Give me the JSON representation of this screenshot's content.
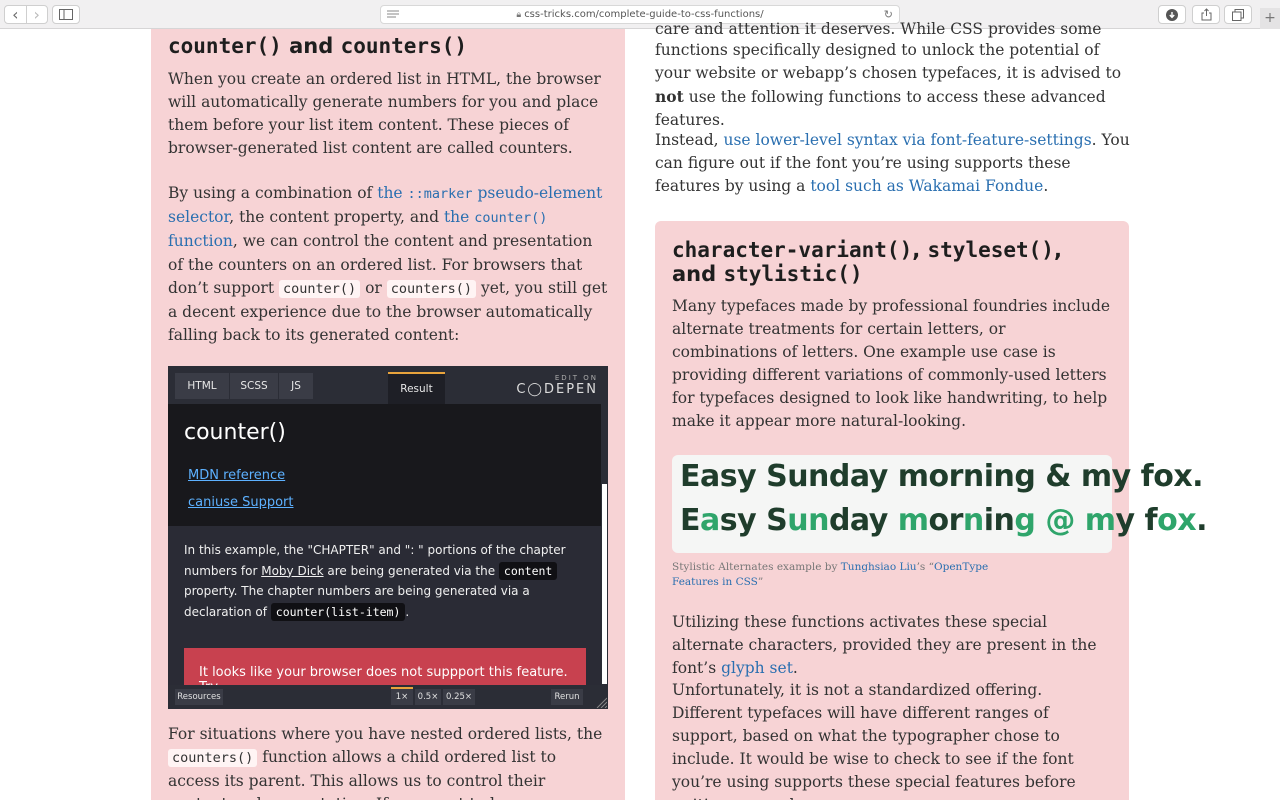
{
  "browser": {
    "url": "css-tricks.com/complete-guide-to-css-functions/",
    "back_glyph": "‹",
    "forward_glyph": "›",
    "icons": [
      "chevron-left-icon",
      "chevron-right-icon",
      "sidebar-icon",
      "reader-icon",
      "lock-icon",
      "reload-icon",
      "download-icon",
      "share-icon",
      "tabs-icon",
      "plus-icon"
    ]
  },
  "left": {
    "heading_code_1": "counter()",
    "heading_and": " and ",
    "heading_code_2": "counters()",
    "p1": "When you create an ordered list in HTML, the browser will automatically generate numbers for you and place them before your list item content. These pieces of browser-generated list content are called counters.",
    "p2_a": "By using a combination of ",
    "p2_link1_pre": "the ",
    "p2_link1_code": "::marker",
    "p2_link1_post": " pseudo-element selector",
    "p2_b": ", the content property, and ",
    "p2_link2_pre": "the ",
    "p2_link2_code": "counter()",
    "p2_link2_post": " function",
    "p2_c": ", we can control the content and presentation of the counters on an ordered list. For browsers that don’t support ",
    "p2_code1": "counter()",
    "p2_or": " or ",
    "p2_code2": "counters()",
    "p2_d": " yet, you still get a decent experience due to the browser automatically falling back to its generated content:",
    "p3_a": "For situations where you have nested ordered lists, the ",
    "p3_code": "counters()",
    "p3_b": " function allows a child ordered list to access its parent. This allows us to control their content and presentation. If you want to learn more about the power of"
  },
  "codepen": {
    "tabs": [
      "HTML",
      "SCSS",
      "JS"
    ],
    "result_tab": "Result",
    "logo_small": "EDIT ON",
    "logo_big": "C◯DEPEN",
    "title": "counter()",
    "link1": "MDN reference",
    "link2": "caniuse Support",
    "desc_a": "In this example, the \"CHAPTER\" and \": \" portions of the chapter numbers for ",
    "desc_link": "Moby Dick",
    "desc_b": " are being generated via the ",
    "desc_code1": "content",
    "desc_c": " property. The chapter numbers are being generated via a declaration of ",
    "desc_code2": "counter(list-item)",
    "desc_d": ".",
    "warning": "It looks like your browser does not suppport this feature. Try",
    "footer": {
      "resources": "Resources",
      "zoom": [
        "1×",
        "0.5×",
        "0.25×"
      ],
      "rerun": "Rerun"
    }
  },
  "right": {
    "top_clip": "care and attention it deserves. While CSS provides some",
    "p1_a": "functions specifically designed to unlock the potential of your website or webapp’s chosen typefaces, it is advised to ",
    "p1_bold": "not",
    "p1_b": " use the following functions to access these advanced features.",
    "p2_a": "Instead, ",
    "p2_link1": "use lower-level syntax via font-feature-settings",
    "p2_b": ". You can figure out if the font you’re using supports these features by using a ",
    "p2_link2": "tool such as Wakamai Fondue",
    "p2_c": ".",
    "card_heading_code1": "character-variant()",
    "card_heading_sep1": ", ",
    "card_heading_code2": "styleset()",
    "card_heading_sep2": ", and ",
    "card_heading_code3": "stylistic()",
    "card_p1": "Many typefaces made by professional foundries include alternate treatments for certain letters, or combinations of letters. One example use case is providing different variations of commonly-used letters for typefaces designed to look like handwriting, to help make it appear more natural-looking.",
    "sample_line1": "Easy Sunday morning & my fox.",
    "sample_line2_parts": [
      "E",
      "a",
      "sy S",
      "un",
      "day ",
      "m",
      "or",
      "n",
      "in",
      "g ",
      "@",
      " m",
      "y f",
      "ox",
      "."
    ],
    "caption_a": "Stylistic Alternates example by ",
    "caption_link1": "Tunghsiao Liu",
    "caption_b": "’s “",
    "caption_link2": "OpenType Features in CSS",
    "caption_c": "”",
    "card_p2_a": "Utilizing these functions activates these special alternate characters, provided they are present in the font’s ",
    "card_p2_link": "glyph set",
    "card_p2_b": ".",
    "card_p3": "Unfortunately, it is not a standardized offering. Different typefaces will have different ranges of support, based on what the typographer chose to include. It would be wise to check to see if the font you’re using supports these special features before writing any code."
  }
}
